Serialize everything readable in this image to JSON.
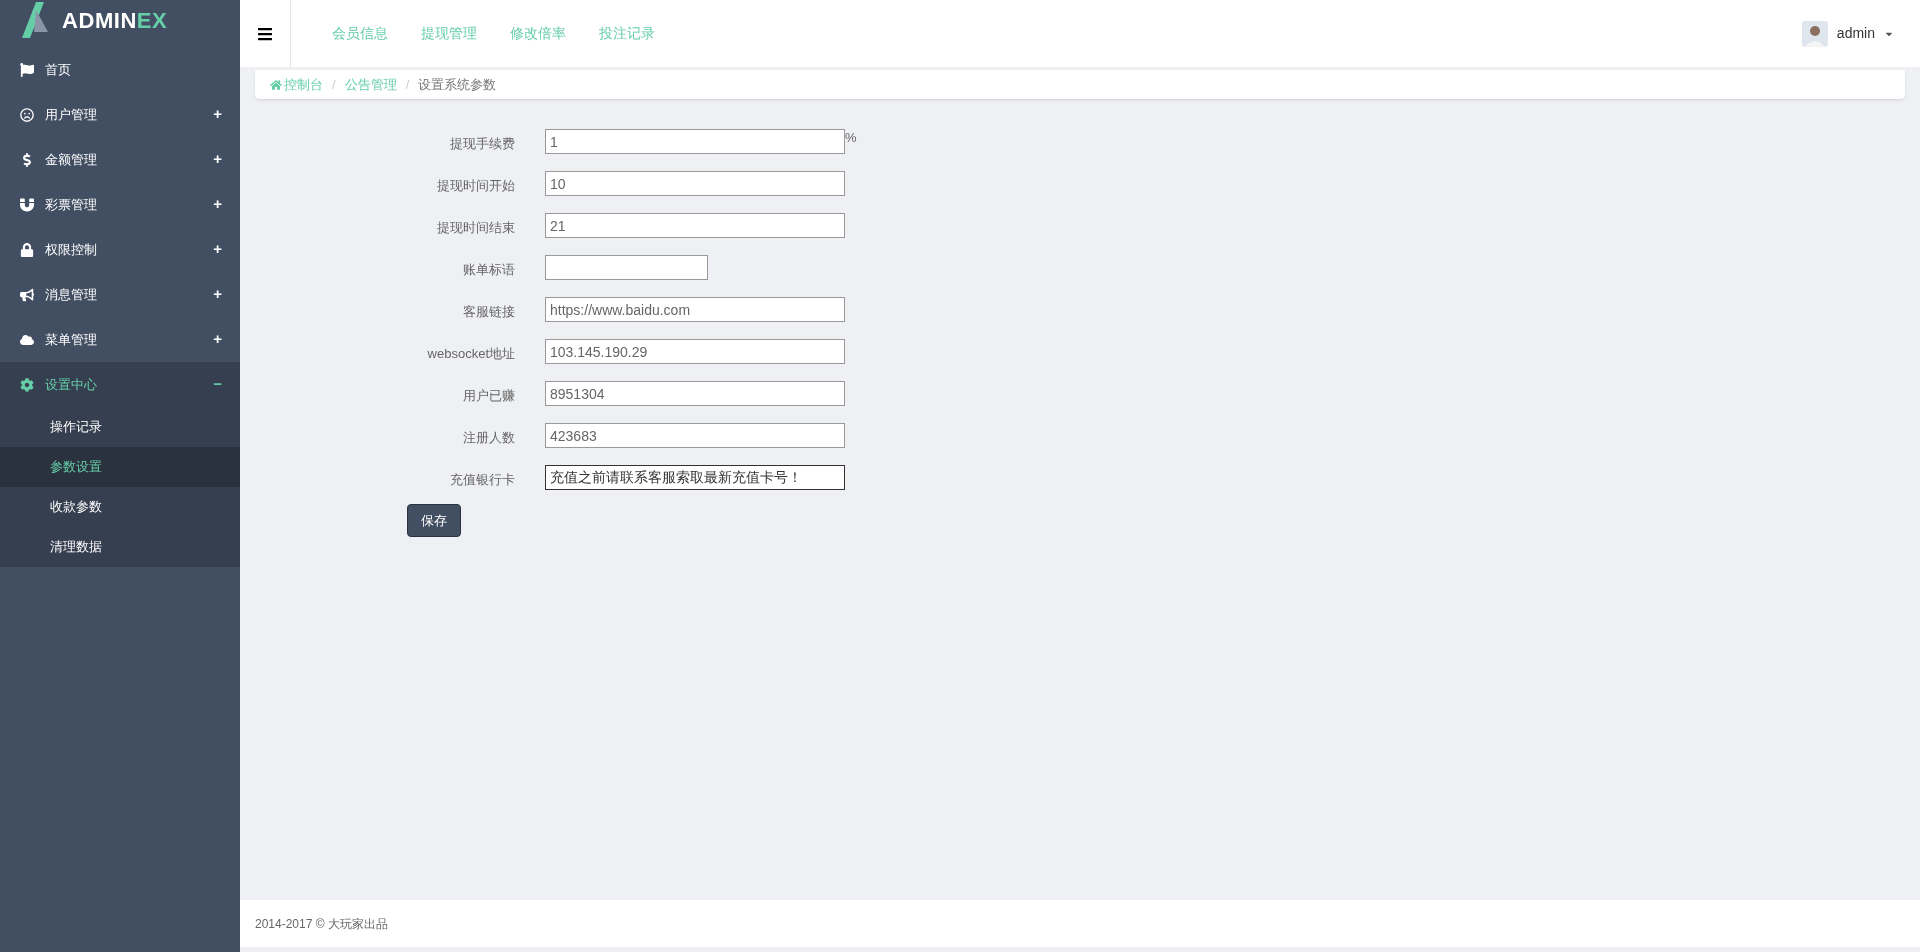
{
  "logo": {
    "main": "ADMIN",
    "accent": "EX"
  },
  "sidebar": {
    "items": [
      {
        "label": "首页",
        "expanded": false
      },
      {
        "label": "用户管理",
        "expander": "+",
        "expanded": false
      },
      {
        "label": "金额管理",
        "expander": "+",
        "expanded": false
      },
      {
        "label": "彩票管理",
        "expander": "+",
        "expanded": false
      },
      {
        "label": "权限控制",
        "expander": "+",
        "expanded": false
      },
      {
        "label": "消息管理",
        "expander": "+",
        "expanded": false
      },
      {
        "label": "菜单管理",
        "expander": "+",
        "expanded": false
      },
      {
        "label": "设置中心",
        "expander": "−",
        "expanded": true,
        "children": [
          {
            "label": "操作记录",
            "selected": false
          },
          {
            "label": "参数设置",
            "selected": true
          },
          {
            "label": "收款参数",
            "selected": false
          },
          {
            "label": "清理数据",
            "selected": false
          }
        ]
      }
    ]
  },
  "top_nav": [
    "会员信息",
    "提现管理",
    "修改倍率",
    "投注记录"
  ],
  "user": {
    "name": "admin"
  },
  "breadcrumb": [
    {
      "label": "控制台",
      "link": true
    },
    {
      "separator": "/"
    },
    {
      "label": "公告管理",
      "link": true
    },
    {
      "separator": "/"
    },
    {
      "label": "设置系统参数",
      "link": false
    }
  ],
  "form": {
    "fields": [
      {
        "label": "提现手续费",
        "value": "1",
        "suffix": "%",
        "kind": "wide"
      },
      {
        "label": "提现时间开始",
        "value": "10",
        "kind": "wide"
      },
      {
        "label": "提现时间结束",
        "value": "21",
        "kind": "wide"
      },
      {
        "label": "账单标语",
        "kind": "short"
      },
      {
        "label": "客服链接",
        "value": "https://www.baidu.com",
        "kind": "wide"
      },
      {
        "label": "websocket地址",
        "value": "103.145.190.29",
        "kind": "wide"
      },
      {
        "label": "用户已赚",
        "value": "8951304",
        "kind": "wide"
      },
      {
        "label": "注册人数",
        "value": "423683",
        "kind": "wide"
      },
      {
        "label": "充值银行卡",
        "value": "充值之前请联系客服索取最新充值卡号！",
        "kind": "dark"
      }
    ],
    "submit": "保存"
  },
  "footer": "2014-2017 © 大玩家出品"
}
